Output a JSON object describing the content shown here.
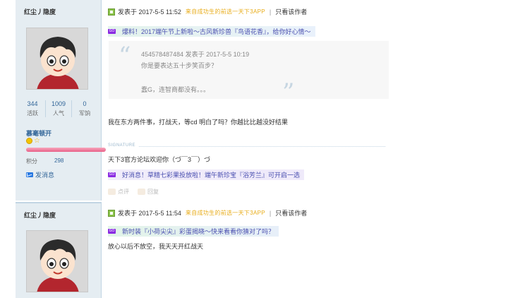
{
  "posts": [
    {
      "username": "红尘丿隐度",
      "stats": [
        {
          "num": "344",
          "label": "活跃"
        },
        {
          "num": "1009",
          "label": "人气"
        },
        {
          "num": "0",
          "label": "军饷"
        }
      ],
      "group": "慕毫顿开",
      "credit_label": "积分",
      "credit_value": "298",
      "pm_label": "发消息",
      "time": "发表于 2017-5-5 11:52",
      "from": "来自成功生的前选一天下3APP",
      "only_author": "只看该作者",
      "ad_top": "爆料！2017端午节上新啦～古风新珍兽『鸟语花香』，给你好心情～",
      "quote": {
        "author_time": "454578487484 发表于 2017-5-5 10:19",
        "line1": "你是要表达五十步笑百步？",
        "line2": "蠢G，连智商都没有。。。"
      },
      "content": "我在东方两件事，打战天，等cd 明白了吗？你越比比越没好结果",
      "signature_label": "SIGNATURE",
      "signature": "天下3官方论坛欢迎你（づ￣3￣）づ",
      "ad_bottom": "好消息！草精七彩果投放啦！端午新珍宝『浴芳兰』可开启一选",
      "actions": [
        "点评",
        "回复"
      ]
    },
    {
      "username": "红尘丿隐度",
      "time": "发表于 2017-5-5 11:54",
      "from": "来自成功生的前选一天下3APP",
      "only_author": "只看该作者",
      "ad_top": "新时装『小荷尖尖』彩蛋揭晓～快来看看你猜对了吗？",
      "content": "放心以后不放空，我天天开红战天"
    }
  ]
}
